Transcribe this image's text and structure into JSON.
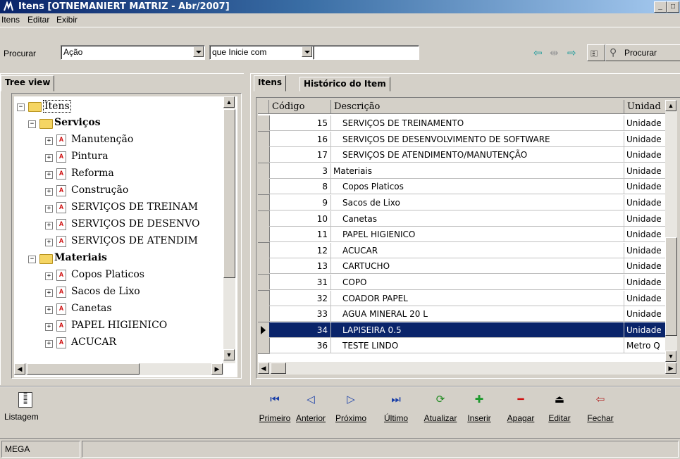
{
  "window": {
    "title": "Itens [OTNEMANIERT MATRIZ - Abr/2007]"
  },
  "menu": [
    "Itens",
    "Editar",
    "Exibir"
  ],
  "toolbar": {
    "search_label": "Procurar",
    "search_field_value": "Ação",
    "condition_value": "que Inicie com",
    "search_text_value": "",
    "search_button_label": "Procurar"
  },
  "left_panel": {
    "tab_label": "Tree view",
    "tree": [
      {
        "label": "Itens",
        "level": 0,
        "kind": "folder",
        "expander": "−",
        "selected": true
      },
      {
        "label": "Serviços",
        "level": 1,
        "kind": "folder",
        "expander": "−",
        "bold": true
      },
      {
        "label": "Manutenção",
        "level": 2,
        "kind": "doc",
        "expander": "+"
      },
      {
        "label": "Pintura",
        "level": 2,
        "kind": "doc",
        "expander": "+"
      },
      {
        "label": "Reforma",
        "level": 2,
        "kind": "doc",
        "expander": "+"
      },
      {
        "label": "Construção",
        "level": 2,
        "kind": "doc",
        "expander": "+"
      },
      {
        "label": "SERVIÇOS DE TREINAM",
        "level": 2,
        "kind": "doc",
        "expander": "+"
      },
      {
        "label": "SERVIÇOS DE DESENVO",
        "level": 2,
        "kind": "doc",
        "expander": "+"
      },
      {
        "label": "SERVIÇOS DE ATENDIM",
        "level": 2,
        "kind": "doc",
        "expander": "+"
      },
      {
        "label": "Materiais",
        "level": 1,
        "kind": "folder",
        "expander": "−",
        "bold": true
      },
      {
        "label": "Copos Platicos",
        "level": 2,
        "kind": "doc",
        "expander": "+"
      },
      {
        "label": "Sacos de Lixo",
        "level": 2,
        "kind": "doc",
        "expander": "+"
      },
      {
        "label": "Canetas",
        "level": 2,
        "kind": "doc",
        "expander": "+"
      },
      {
        "label": "PAPEL HIGIENICO",
        "level": 2,
        "kind": "doc",
        "expander": "+"
      },
      {
        "label": "ACUCAR",
        "level": 2,
        "kind": "doc",
        "expander": "+"
      }
    ]
  },
  "right_panel": {
    "tabs": [
      "Itens",
      "Histórico do Item"
    ],
    "columns": [
      "Código",
      "Descrição",
      "Unidad"
    ],
    "rows": [
      {
        "codigo": "15",
        "descricao": "SERVIÇOS DE TREINAMENTO",
        "unidade": "Unidade"
      },
      {
        "codigo": "16",
        "descricao": "SERVIÇOS DE DESENVOLVIMENTO DE SOFTWARE",
        "unidade": "Unidade"
      },
      {
        "codigo": "17",
        "descricao": "SERVIÇOS DE ATENDIMENTO/MANUTENÇÃO",
        "unidade": "Unidade"
      },
      {
        "codigo": "3",
        "descricao": "Materiais",
        "unidade": "Unidade",
        "group": true
      },
      {
        "codigo": "8",
        "descricao": "Copos Platicos",
        "unidade": "Unidade"
      },
      {
        "codigo": "9",
        "descricao": "Sacos de Lixo",
        "unidade": "Unidade"
      },
      {
        "codigo": "10",
        "descricao": "Canetas",
        "unidade": "Unidade"
      },
      {
        "codigo": "11",
        "descricao": "PAPEL HIGIENICO",
        "unidade": "Unidade"
      },
      {
        "codigo": "12",
        "descricao": "ACUCAR",
        "unidade": "Unidade"
      },
      {
        "codigo": "13",
        "descricao": "CARTUCHO",
        "unidade": "Unidade"
      },
      {
        "codigo": "31",
        "descricao": "COPO",
        "unidade": "Unidade"
      },
      {
        "codigo": "32",
        "descricao": "COADOR PAPEL",
        "unidade": "Unidade"
      },
      {
        "codigo": "33",
        "descricao": "AGUA MINERAL 20 L",
        "unidade": "Unidade"
      },
      {
        "codigo": "34",
        "descricao": "LAPISEIRA 0.5",
        "unidade": "Unidade",
        "selected": true
      },
      {
        "codigo": "36",
        "descricao": "TESTE LINDO",
        "unidade": "Metro Q"
      }
    ]
  },
  "bottom": {
    "listagem": "Listagem",
    "nav": [
      {
        "label": "Primeiro",
        "icon": "first-record-icon",
        "glyph": "⏮",
        "color": "#1a3fa8"
      },
      {
        "label": "Anterior",
        "icon": "previous-record-icon",
        "glyph": "◁",
        "color": "#1a3fa8"
      },
      {
        "label": "Próximo",
        "icon": "next-record-icon",
        "glyph": "▷",
        "color": "#1a3fa8"
      },
      {
        "label": "Último",
        "icon": "last-record-icon",
        "glyph": "⏭",
        "color": "#1a3fa8"
      },
      {
        "label": "Atualizar",
        "icon": "refresh-icon",
        "glyph": "⟳",
        "color": "#1f8a1f"
      },
      {
        "label": "Inserir",
        "icon": "insert-icon",
        "glyph": "✚",
        "color": "#1f9a2f"
      },
      {
        "label": "Apagar",
        "icon": "delete-icon",
        "glyph": "━",
        "color": "#d01010"
      },
      {
        "label": "Editar",
        "icon": "edit-icon",
        "glyph": "⏏",
        "color": "#000000"
      },
      {
        "label": "Fechar",
        "icon": "close-door-icon",
        "glyph": "⇦",
        "color": "#b02020"
      }
    ]
  },
  "status": {
    "text": "MEGA"
  }
}
